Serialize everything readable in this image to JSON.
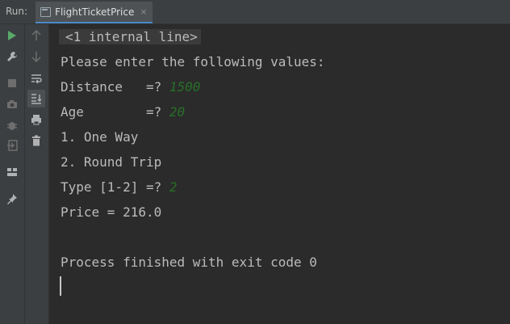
{
  "header": {
    "run_label": "Run:",
    "tab_label": "FlightTicketPrice",
    "tab_close": "×"
  },
  "toolbar_left": [
    {
      "name": "rerun-icon",
      "color": "#59a869"
    },
    {
      "name": "wrench-icon"
    },
    {
      "name": "stop-icon"
    },
    {
      "name": "camera-icon"
    },
    {
      "name": "bug-icon"
    },
    {
      "name": "exit-icon"
    },
    {
      "name": "layout-icon"
    },
    {
      "name": "pin-icon"
    }
  ],
  "toolbar_right": [
    {
      "name": "up-arrow-icon"
    },
    {
      "name": "down-arrow-icon"
    },
    {
      "name": "soft-wrap-icon"
    },
    {
      "name": "scroll-to-end-icon",
      "active": true
    },
    {
      "name": "print-icon"
    },
    {
      "name": "trash-icon"
    }
  ],
  "console": {
    "internal_line": "<1 internal line>",
    "prompt_header": "Please enter the following values:",
    "distance_prompt": "Distance   =? ",
    "distance_value": "1500",
    "age_prompt": "Age        =? ",
    "age_value": "20",
    "option_1": "1. One Way",
    "option_2": "2. Round Trip",
    "type_prompt": "Type [1-2] =? ",
    "type_value": "2",
    "price_line": "Price = 216.0",
    "exit_line": "Process finished with exit code 0"
  },
  "colors": {
    "background": "#2b2b2b",
    "toolbar": "#3c3f41",
    "user_input": "#287028",
    "text": "#bbbbbb",
    "tab_underline": "#4a88c7"
  }
}
